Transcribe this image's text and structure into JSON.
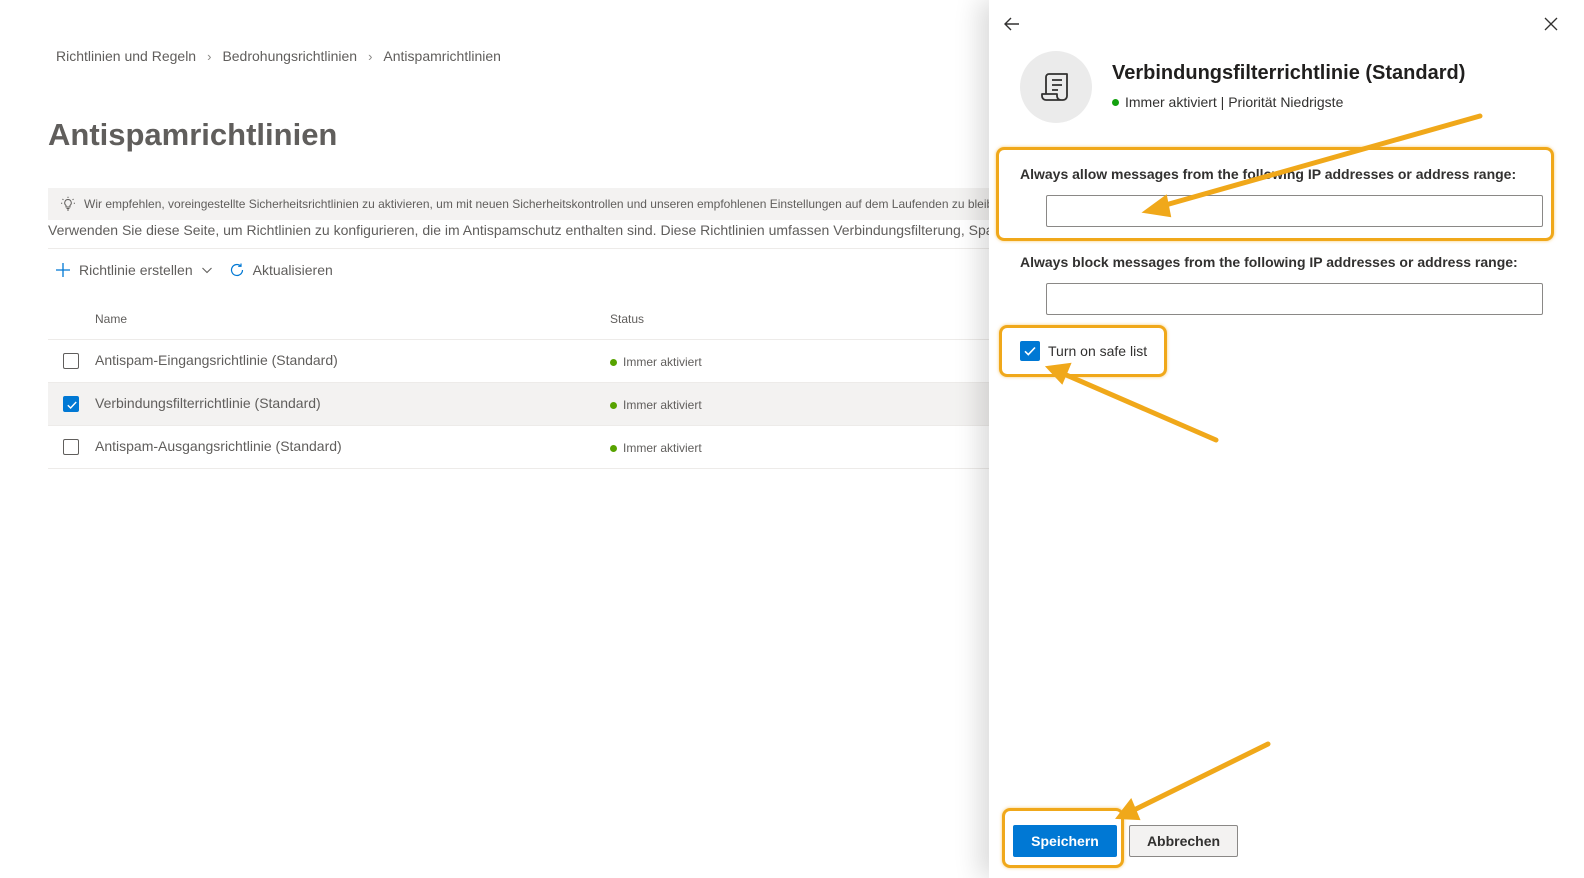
{
  "breadcrumb": [
    "Richtlinien und Regeln",
    "Bedrohungsrichtlinien",
    "Antispamrichtlinien"
  ],
  "page": {
    "title": "Antispamrichtlinien",
    "tip": "Wir empfehlen, voreingestellte Sicherheitsrichtlinien zu aktivieren, um mit neuen Sicherheitskontrollen und unseren empfohlenen Einstellungen auf dem Laufenden zu bleiben.",
    "description": "Verwenden Sie diese Seite, um Richtlinien zu konfigurieren, die im Antispamschutz enthalten sind. Diese Richtlinien umfassen Verbindungsfilterung, Spamfilterung und Ausgangsspamfilterung."
  },
  "commands": {
    "create": "Richtlinie erstellen",
    "refresh": "Aktualisieren"
  },
  "table": {
    "columns": {
      "name": "Name",
      "status": "Status"
    },
    "rows": [
      {
        "name": "Antispam-Eingangsrichtlinie (Standard)",
        "status": "Immer aktiviert",
        "selected": false
      },
      {
        "name": "Verbindungsfilterrichtlinie (Standard)",
        "status": "Immer aktiviert",
        "selected": true
      },
      {
        "name": "Antispam-Ausgangsrichtlinie (Standard)",
        "status": "Immer aktiviert",
        "selected": false
      }
    ]
  },
  "panel": {
    "title": "Verbindungsfilterrichtlinie (Standard)",
    "subtitle": "Immer aktiviert | Priorität Niedrigste",
    "allow_label": "Always allow messages from the following IP addresses or address range:",
    "allow_value": "",
    "block_label": "Always block messages from the following IP addresses or address range:",
    "block_value": "",
    "safe_list_label": "Turn on safe list",
    "safe_list_checked": true,
    "save_label": "Speichern",
    "cancel_label": "Abbrechen"
  },
  "colors": {
    "accent": "#0078d4",
    "annotation": "#f0a81a",
    "status_dot": "#57a300"
  },
  "icons": [
    "chevron-right-icon",
    "lightbulb-icon",
    "add-icon",
    "chevron-down-icon",
    "refresh-icon",
    "checkmark-icon",
    "back-arrow-icon",
    "close-icon",
    "policy-document-icon"
  ]
}
